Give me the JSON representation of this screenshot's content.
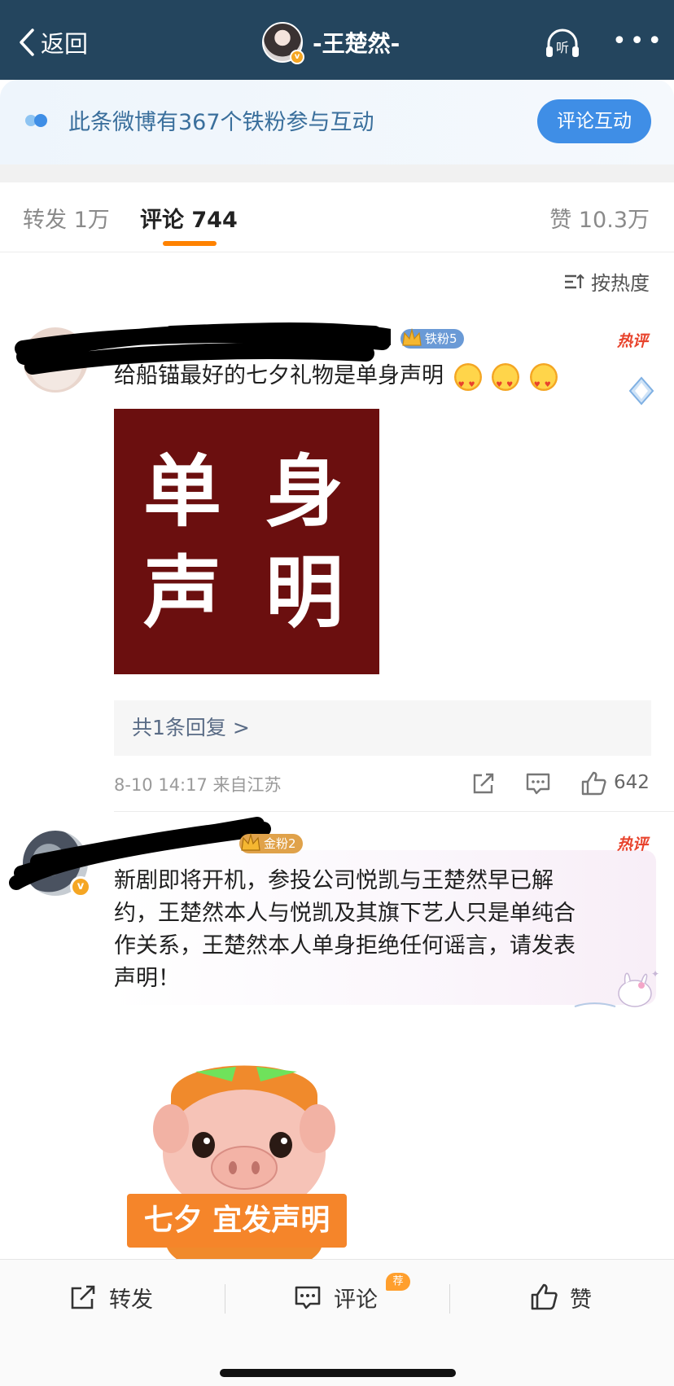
{
  "nav": {
    "back_label": "返回",
    "title": "-王楚然-",
    "listen_label": "听",
    "more_label": "•••"
  },
  "banner": {
    "text": "此条微博有367个铁粉参与互动",
    "button_label": "评论互动"
  },
  "tabs": {
    "repost": "转发 1万",
    "comment": "评论 744",
    "like": "赞 10.3万"
  },
  "sort_label": "按热度",
  "comments": [
    {
      "fan_badge": "铁粉5",
      "hot_label": "热评",
      "text": "给船锚最好的七夕礼物是单身声明",
      "sticker_chars": [
        "单",
        "身",
        "声",
        "明"
      ],
      "replies_label": "共1条回复 >",
      "meta": "8-10 14:17  来自江苏",
      "like_count": "642"
    },
    {
      "fan_badge": "金粉2",
      "hot_label": "热评",
      "text_lines": [
        "新剧即将开机，参投公司悦凯与王楚然早已解",
        "约，王楚然本人与悦凯及其旗下艺人只是单纯合",
        "作关系，王楚然本人单身拒绝任何谣言，请发表",
        "声明！"
      ],
      "sticker_caption": "七夕 宜发声明"
    }
  ],
  "bottom": {
    "repost": "转发",
    "comment": "评论",
    "comment_badge": "荐",
    "like": "赞"
  },
  "colors": {
    "nav_bg": "#24455e",
    "accent_orange": "#ff8200",
    "banner_button": "#3f8ee6",
    "hot_red": "#e8432c"
  }
}
